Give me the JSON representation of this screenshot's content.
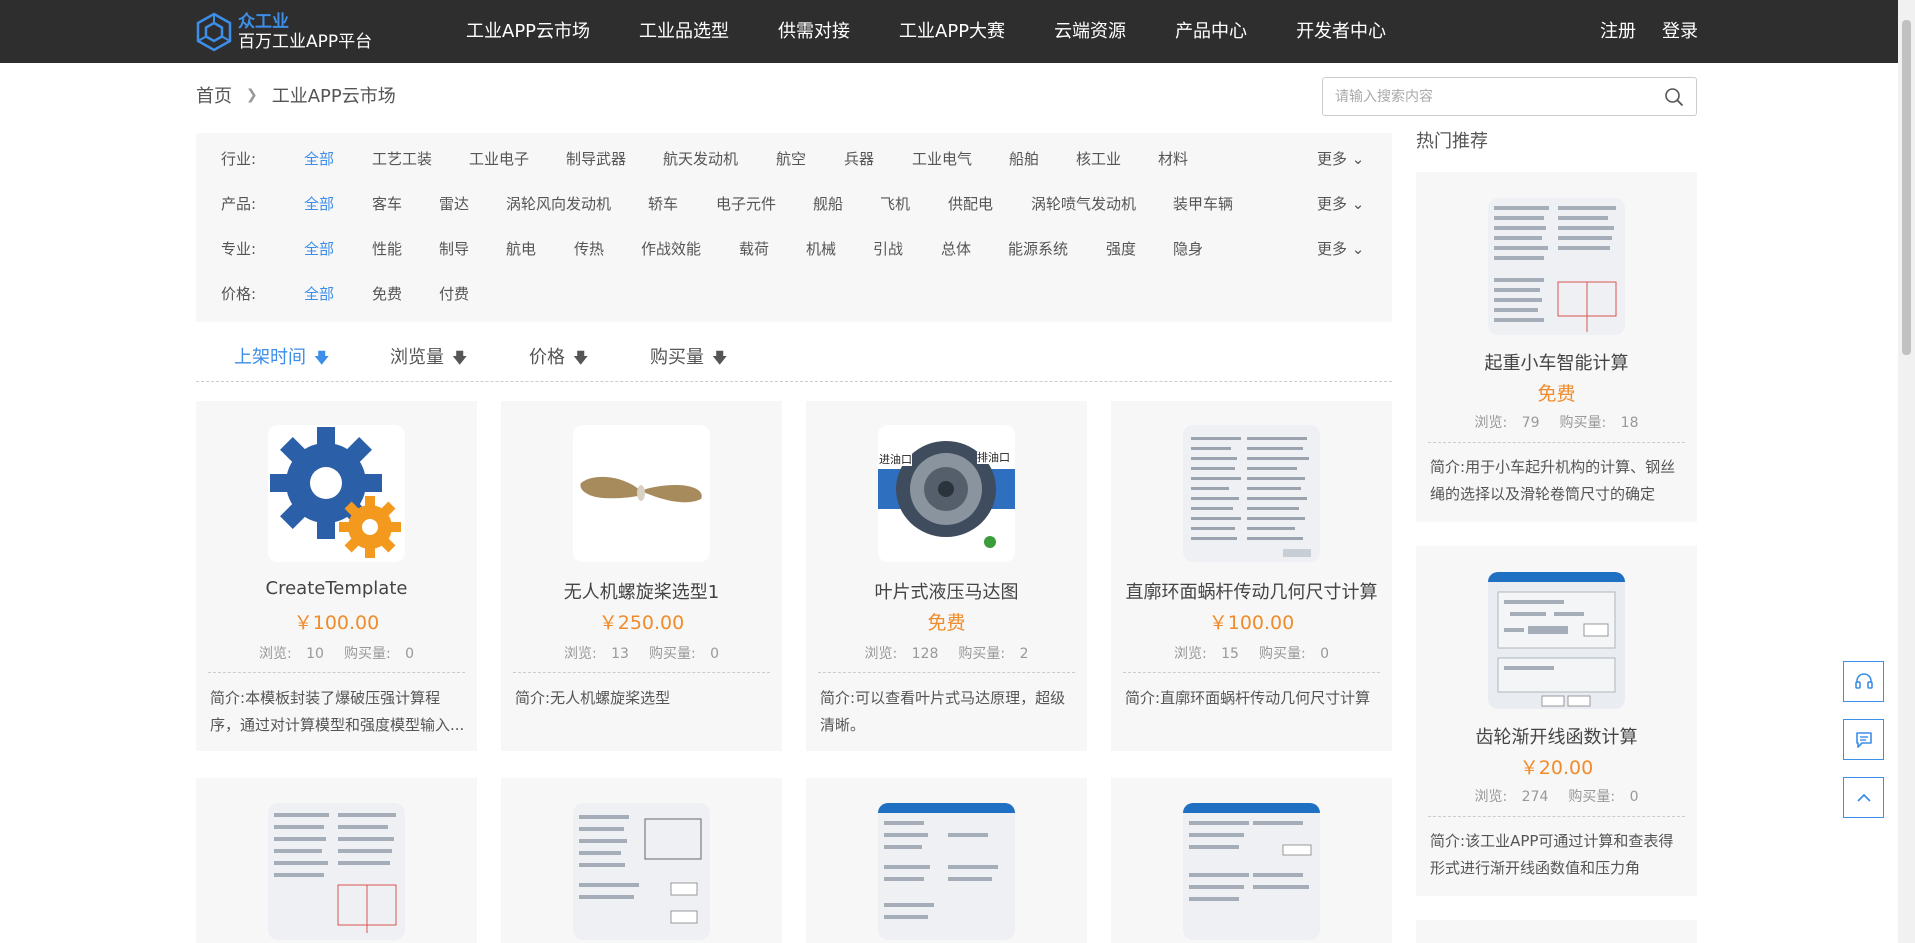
{
  "header": {
    "logo_top": "众工业",
    "logo_bottom": "百万工业APP平台",
    "nav": [
      "工业APP云市场",
      "工业品选型",
      "供需对接",
      "工业APP大赛",
      "云端资源",
      "产品中心",
      "开发者中心"
    ],
    "register": "注册",
    "login": "登录"
  },
  "breadcrumb": {
    "home": "首页",
    "current": "工业APP云市场"
  },
  "search": {
    "placeholder": "请输入搜索内容"
  },
  "filters": {
    "industry": {
      "label": "行业:",
      "options": [
        "全部",
        "工艺工装",
        "工业电子",
        "制导武器",
        "航天发动机",
        "航空",
        "兵器",
        "工业电气",
        "船舶",
        "核工业",
        "材料"
      ],
      "more": "更多"
    },
    "product": {
      "label": "产品:",
      "options": [
        "全部",
        "客车",
        "雷达",
        "涡轮风向发动机",
        "轿车",
        "电子元件",
        "舰船",
        "飞机",
        "供配电",
        "涡轮喷气发动机",
        "装甲车辆"
      ],
      "more": "更多"
    },
    "specialty": {
      "label": "专业:",
      "options": [
        "全部",
        "性能",
        "制导",
        "航电",
        "传热",
        "作战效能",
        "载荷",
        "机械",
        "引战",
        "总体",
        "能源系统",
        "强度",
        "隐身"
      ],
      "more": "更多"
    },
    "price": {
      "label": "价格:",
      "options": [
        "全部",
        "免费",
        "付费"
      ]
    }
  },
  "sort": [
    "上架时间",
    "浏览量",
    "价格",
    "购买量"
  ],
  "stat_labels": {
    "views": "浏览:",
    "buys": "购买量:"
  },
  "desc_prefix": "简介:",
  "cards": [
    {
      "title": "CreateTemplate",
      "price": "￥100.00",
      "views": "10",
      "buys": "0",
      "desc": "本模板封装了爆破压强计算程序，通过对计算模型和强度模型输入..."
    },
    {
      "title": "无人机螺旋桨选型1",
      "price": "￥250.00",
      "views": "13",
      "buys": "0",
      "desc": "无人机螺旋桨选型"
    },
    {
      "title": "叶片式液压马达图",
      "price": "免费",
      "views": "128",
      "buys": "2",
      "desc": "可以查看叶片式马达原理，超级清晰。",
      "thumb_labels": [
        "进油口",
        "排油口"
      ]
    },
    {
      "title": "直廓环面蜗杆传动几何尺寸计算",
      "price": "￥100.00",
      "views": "15",
      "buys": "0",
      "desc": "直廓环面蜗杆传动几何尺寸计算"
    }
  ],
  "hot": {
    "title": "热门推荐",
    "items": [
      {
        "title": "起重小车智能计算",
        "price": "免费",
        "views": "79",
        "buys": "18",
        "desc": "用于小车起升机构的计算、钢丝绳的选择以及滑轮卷筒尺寸的确定"
      },
      {
        "title": "齿轮渐开线函数计算",
        "price": "￥20.00",
        "views": "274",
        "buys": "0",
        "desc": "该工业APP可通过计算和查表得形式进行渐开线函数值和压力角"
      }
    ]
  },
  "colors": {
    "accent": "#3d8ee8",
    "price": "#f08c2b",
    "header_bg": "#2e2e2e"
  },
  "icons": [
    "logo-hexagon-icon",
    "search-icon",
    "chevron-down-icon",
    "arrow-down-icon",
    "headset-icon",
    "chat-icon",
    "chevron-up-icon"
  ]
}
